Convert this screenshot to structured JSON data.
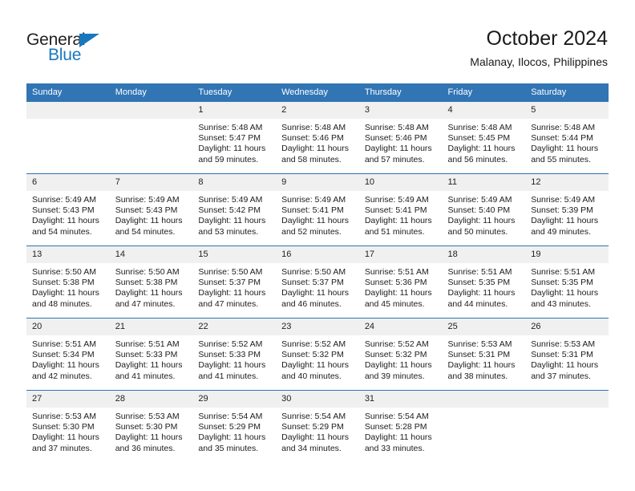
{
  "logo": {
    "text_primary": "General",
    "text_secondary": "Blue",
    "triangle_icon": "triangle-icon",
    "color_primary": "#231f20",
    "color_secondary": "#1878be"
  },
  "header": {
    "title": "October 2024",
    "subtitle": "Malanay, Ilocos, Philippines"
  },
  "theme": {
    "header_blue": "#3175b4",
    "row_divider": "#2f74b5",
    "daynum_band": "#f0f0f0"
  },
  "calendar": {
    "weekday_headers": [
      "Sunday",
      "Monday",
      "Tuesday",
      "Wednesday",
      "Thursday",
      "Friday",
      "Saturday"
    ],
    "weeks": [
      [
        {
          "day": "",
          "empty": true
        },
        {
          "day": "",
          "empty": true
        },
        {
          "day": "1",
          "sunrise": "Sunrise: 5:48 AM",
          "sunset": "Sunset: 5:47 PM",
          "daylight_1": "Daylight: 11 hours",
          "daylight_2": "and 59 minutes."
        },
        {
          "day": "2",
          "sunrise": "Sunrise: 5:48 AM",
          "sunset": "Sunset: 5:46 PM",
          "daylight_1": "Daylight: 11 hours",
          "daylight_2": "and 58 minutes."
        },
        {
          "day": "3",
          "sunrise": "Sunrise: 5:48 AM",
          "sunset": "Sunset: 5:46 PM",
          "daylight_1": "Daylight: 11 hours",
          "daylight_2": "and 57 minutes."
        },
        {
          "day": "4",
          "sunrise": "Sunrise: 5:48 AM",
          "sunset": "Sunset: 5:45 PM",
          "daylight_1": "Daylight: 11 hours",
          "daylight_2": "and 56 minutes."
        },
        {
          "day": "5",
          "sunrise": "Sunrise: 5:48 AM",
          "sunset": "Sunset: 5:44 PM",
          "daylight_1": "Daylight: 11 hours",
          "daylight_2": "and 55 minutes."
        }
      ],
      [
        {
          "day": "6",
          "sunrise": "Sunrise: 5:49 AM",
          "sunset": "Sunset: 5:43 PM",
          "daylight_1": "Daylight: 11 hours",
          "daylight_2": "and 54 minutes."
        },
        {
          "day": "7",
          "sunrise": "Sunrise: 5:49 AM",
          "sunset": "Sunset: 5:43 PM",
          "daylight_1": "Daylight: 11 hours",
          "daylight_2": "and 54 minutes."
        },
        {
          "day": "8",
          "sunrise": "Sunrise: 5:49 AM",
          "sunset": "Sunset: 5:42 PM",
          "daylight_1": "Daylight: 11 hours",
          "daylight_2": "and 53 minutes."
        },
        {
          "day": "9",
          "sunrise": "Sunrise: 5:49 AM",
          "sunset": "Sunset: 5:41 PM",
          "daylight_1": "Daylight: 11 hours",
          "daylight_2": "and 52 minutes."
        },
        {
          "day": "10",
          "sunrise": "Sunrise: 5:49 AM",
          "sunset": "Sunset: 5:41 PM",
          "daylight_1": "Daylight: 11 hours",
          "daylight_2": "and 51 minutes."
        },
        {
          "day": "11",
          "sunrise": "Sunrise: 5:49 AM",
          "sunset": "Sunset: 5:40 PM",
          "daylight_1": "Daylight: 11 hours",
          "daylight_2": "and 50 minutes."
        },
        {
          "day": "12",
          "sunrise": "Sunrise: 5:49 AM",
          "sunset": "Sunset: 5:39 PM",
          "daylight_1": "Daylight: 11 hours",
          "daylight_2": "and 49 minutes."
        }
      ],
      [
        {
          "day": "13",
          "sunrise": "Sunrise: 5:50 AM",
          "sunset": "Sunset: 5:38 PM",
          "daylight_1": "Daylight: 11 hours",
          "daylight_2": "and 48 minutes."
        },
        {
          "day": "14",
          "sunrise": "Sunrise: 5:50 AM",
          "sunset": "Sunset: 5:38 PM",
          "daylight_1": "Daylight: 11 hours",
          "daylight_2": "and 47 minutes."
        },
        {
          "day": "15",
          "sunrise": "Sunrise: 5:50 AM",
          "sunset": "Sunset: 5:37 PM",
          "daylight_1": "Daylight: 11 hours",
          "daylight_2": "and 47 minutes."
        },
        {
          "day": "16",
          "sunrise": "Sunrise: 5:50 AM",
          "sunset": "Sunset: 5:37 PM",
          "daylight_1": "Daylight: 11 hours",
          "daylight_2": "and 46 minutes."
        },
        {
          "day": "17",
          "sunrise": "Sunrise: 5:51 AM",
          "sunset": "Sunset: 5:36 PM",
          "daylight_1": "Daylight: 11 hours",
          "daylight_2": "and 45 minutes."
        },
        {
          "day": "18",
          "sunrise": "Sunrise: 5:51 AM",
          "sunset": "Sunset: 5:35 PM",
          "daylight_1": "Daylight: 11 hours",
          "daylight_2": "and 44 minutes."
        },
        {
          "day": "19",
          "sunrise": "Sunrise: 5:51 AM",
          "sunset": "Sunset: 5:35 PM",
          "daylight_1": "Daylight: 11 hours",
          "daylight_2": "and 43 minutes."
        }
      ],
      [
        {
          "day": "20",
          "sunrise": "Sunrise: 5:51 AM",
          "sunset": "Sunset: 5:34 PM",
          "daylight_1": "Daylight: 11 hours",
          "daylight_2": "and 42 minutes."
        },
        {
          "day": "21",
          "sunrise": "Sunrise: 5:51 AM",
          "sunset": "Sunset: 5:33 PM",
          "daylight_1": "Daylight: 11 hours",
          "daylight_2": "and 41 minutes."
        },
        {
          "day": "22",
          "sunrise": "Sunrise: 5:52 AM",
          "sunset": "Sunset: 5:33 PM",
          "daylight_1": "Daylight: 11 hours",
          "daylight_2": "and 41 minutes."
        },
        {
          "day": "23",
          "sunrise": "Sunrise: 5:52 AM",
          "sunset": "Sunset: 5:32 PM",
          "daylight_1": "Daylight: 11 hours",
          "daylight_2": "and 40 minutes."
        },
        {
          "day": "24",
          "sunrise": "Sunrise: 5:52 AM",
          "sunset": "Sunset: 5:32 PM",
          "daylight_1": "Daylight: 11 hours",
          "daylight_2": "and 39 minutes."
        },
        {
          "day": "25",
          "sunrise": "Sunrise: 5:53 AM",
          "sunset": "Sunset: 5:31 PM",
          "daylight_1": "Daylight: 11 hours",
          "daylight_2": "and 38 minutes."
        },
        {
          "day": "26",
          "sunrise": "Sunrise: 5:53 AM",
          "sunset": "Sunset: 5:31 PM",
          "daylight_1": "Daylight: 11 hours",
          "daylight_2": "and 37 minutes."
        }
      ],
      [
        {
          "day": "27",
          "sunrise": "Sunrise: 5:53 AM",
          "sunset": "Sunset: 5:30 PM",
          "daylight_1": "Daylight: 11 hours",
          "daylight_2": "and 37 minutes."
        },
        {
          "day": "28",
          "sunrise": "Sunrise: 5:53 AM",
          "sunset": "Sunset: 5:30 PM",
          "daylight_1": "Daylight: 11 hours",
          "daylight_2": "and 36 minutes."
        },
        {
          "day": "29",
          "sunrise": "Sunrise: 5:54 AM",
          "sunset": "Sunset: 5:29 PM",
          "daylight_1": "Daylight: 11 hours",
          "daylight_2": "and 35 minutes."
        },
        {
          "day": "30",
          "sunrise": "Sunrise: 5:54 AM",
          "sunset": "Sunset: 5:29 PM",
          "daylight_1": "Daylight: 11 hours",
          "daylight_2": "and 34 minutes."
        },
        {
          "day": "31",
          "sunrise": "Sunrise: 5:54 AM",
          "sunset": "Sunset: 5:28 PM",
          "daylight_1": "Daylight: 11 hours",
          "daylight_2": "and 33 minutes."
        },
        {
          "day": "",
          "empty": true
        },
        {
          "day": "",
          "empty": true
        }
      ]
    ]
  }
}
